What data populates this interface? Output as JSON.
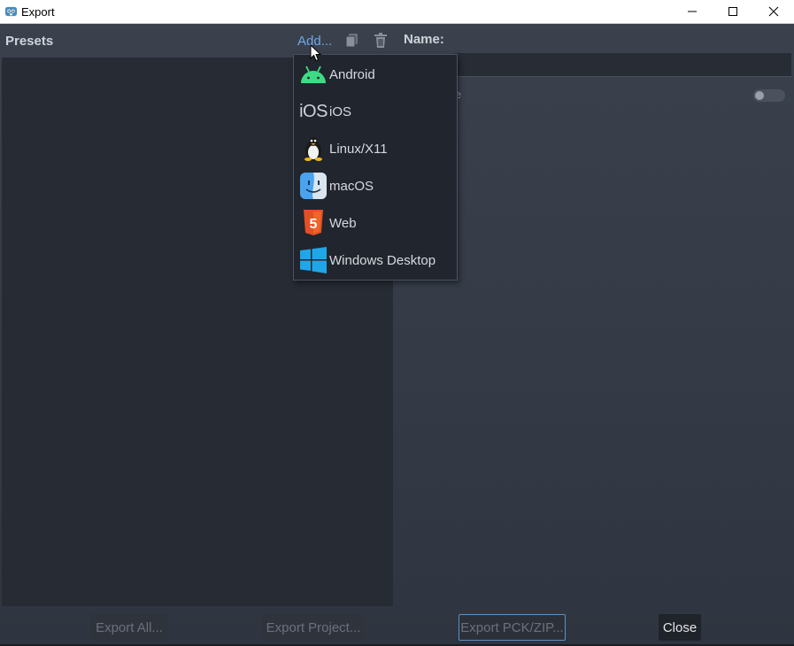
{
  "window": {
    "title": "Export",
    "controls": {
      "minimize": "—",
      "maximize": "☐",
      "close": "✕"
    }
  },
  "header": {
    "presets_label": "Presets",
    "add_label": "Add...",
    "name_label": "Name:",
    "duplicate_icon": "duplicate-icon",
    "delete_icon": "trash-icon"
  },
  "options": {
    "runnable_hint_fragment": "e",
    "runnable_toggle_on": false
  },
  "add_menu": {
    "items": [
      {
        "label": "Android",
        "icon": "android-icon"
      },
      {
        "label": "iOS",
        "icon": "ios-icon",
        "logo_text": "iOS"
      },
      {
        "label": "Linux/X11",
        "icon": "linux-icon"
      },
      {
        "label": "macOS",
        "icon": "macos-icon"
      },
      {
        "label": "Web",
        "icon": "html5-icon",
        "logo_text": "5"
      },
      {
        "label": "Windows Desktop",
        "icon": "windows-icon"
      }
    ]
  },
  "footer": {
    "export_all": "Export All...",
    "export_project": "Export Project...",
    "export_pck": "Export PCK/ZIP...",
    "close": "Close"
  },
  "colors": {
    "accent": "#6fa8ea",
    "android": "#3ddc84",
    "html5": "#e34f26",
    "windows": "#1fa6e8",
    "macos": "#4aa3ef"
  }
}
